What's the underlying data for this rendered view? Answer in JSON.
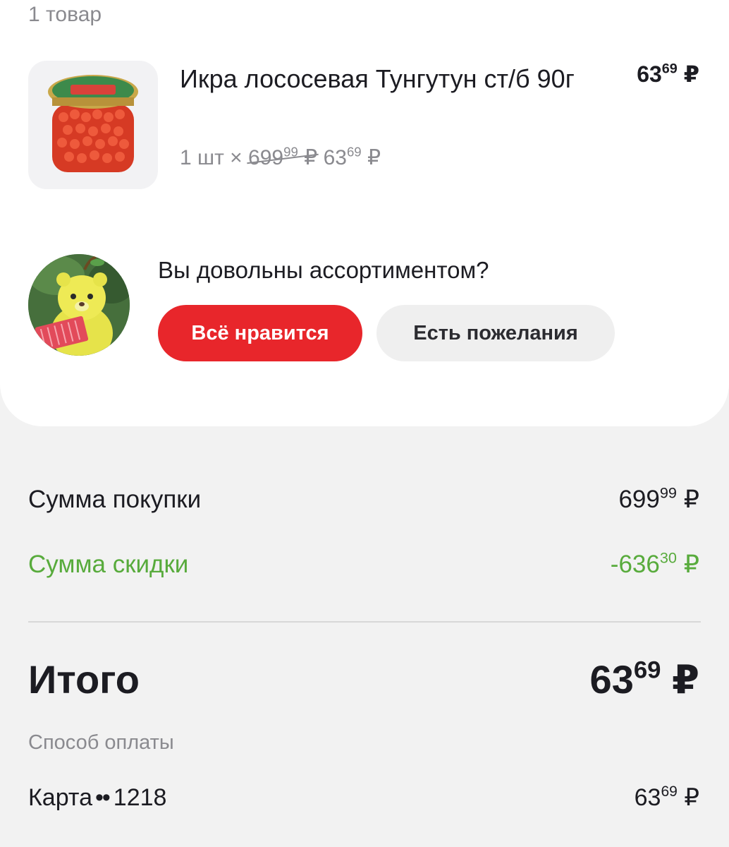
{
  "items_count": "1 товар",
  "product": {
    "name": "Икра лососевая Тунгутун ст/б 90г",
    "qty": "1 шт",
    "times": "×",
    "old_price_int": "699",
    "old_price_frac": "99",
    "unit_price_int": "63",
    "unit_price_frac": "69",
    "total_int": "63",
    "total_frac": "69",
    "currency": "₽"
  },
  "survey": {
    "question": "Вы довольны ассортиментом?",
    "like_label": "Всё нравится",
    "wish_label": "Есть пожелания"
  },
  "summary": {
    "purchase_label": "Сумма покупки",
    "purchase_int": "699",
    "purchase_frac": "99",
    "discount_label": "Сумма скидки",
    "discount_int": "-636",
    "discount_frac": "30",
    "total_label": "Итого",
    "total_int": "63",
    "total_frac": "69",
    "currency": "₽"
  },
  "payment": {
    "label": "Способ оплаты",
    "method": "Карта",
    "dots": "••",
    "card_last4": "1218",
    "amount_int": "63",
    "amount_frac": "69"
  },
  "colors": {
    "accent_red": "#e8262b",
    "discount_green": "#58ab3c",
    "muted_text": "#8a8a8f"
  }
}
